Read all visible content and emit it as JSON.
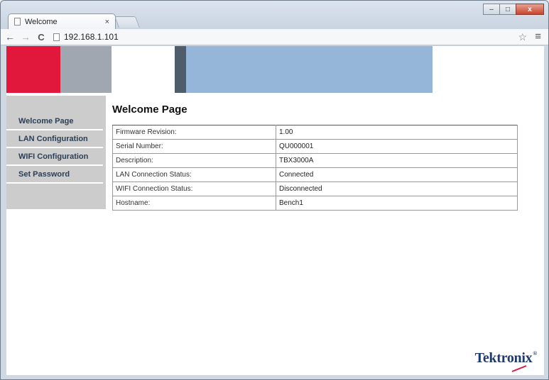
{
  "browser": {
    "tab_title": "Welcome",
    "tab_close": "×",
    "url": "192.168.1.101",
    "window_buttons": {
      "minimize": "–",
      "maximize": "□",
      "close": "x"
    }
  },
  "sidebar": {
    "items": [
      {
        "label": "Welcome Page"
      },
      {
        "label": "LAN Configuration"
      },
      {
        "label": "WIFI Configuration"
      },
      {
        "label": "Set Password"
      }
    ]
  },
  "main": {
    "title": "Welcome Page",
    "rows": [
      {
        "label": "Firmware Revision:",
        "value": "1.00"
      },
      {
        "label": "Serial Number:",
        "value": "QU000001"
      },
      {
        "label": "Description:",
        "value": "TBX3000A"
      },
      {
        "label": "LAN Connection Status:",
        "value": "Connected"
      },
      {
        "label": "WIFI Connection Status:",
        "value": "Disconnected"
      },
      {
        "label": "Hostname:",
        "value": "Bench1"
      }
    ]
  },
  "logo": {
    "text": "Tektronix",
    "mark": "®"
  },
  "colors": {
    "banner_red": "#e2173c",
    "banner_grey": "#a0a7b1",
    "banner_dark": "#4f5c6a",
    "banner_blue": "#95b5d9",
    "sidebar_bg": "#cccccc",
    "nav_text": "#2c3e56",
    "logo_blue": "#1f3a6e",
    "logo_red": "#e2173c"
  }
}
